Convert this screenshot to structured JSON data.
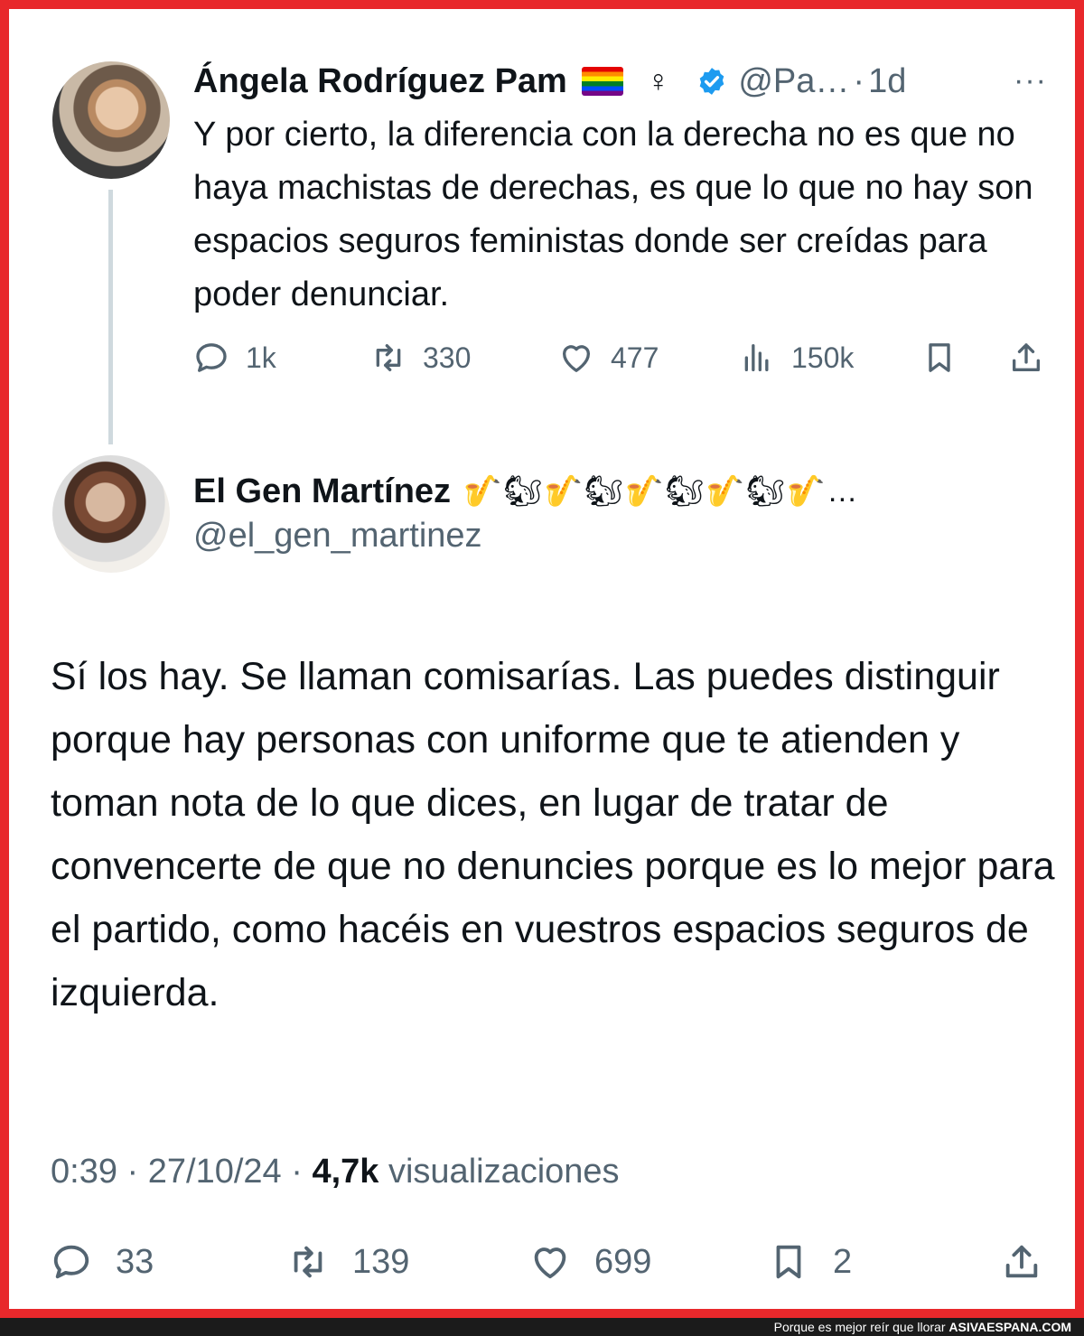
{
  "tweet_main": {
    "author_name": "Ángela Rodríguez Pam",
    "female_symbol": "♀",
    "handle_truncated": "@Pa…",
    "separator": "·",
    "time_ago": "1d",
    "more": "···",
    "text": "Y por cierto, la diferencia con la derecha no es que no haya machistas de derechas, es que lo que no hay son espacios seguros feministas donde ser creídas para poder denunciar.",
    "stats": {
      "replies": "1k",
      "retweets": "330",
      "likes": "477",
      "views": "150k"
    }
  },
  "reply": {
    "author_name": "El Gen Martínez",
    "name_emojis": "🎷🐿🎷🐿🎷🐿🎷🐿🎷…",
    "handle": "@el_gen_martinez",
    "text": "Sí los hay. Se llaman comisarías. Las puedes distinguir porque hay personas con uniforme que te atienden y toman nota de lo que dices, en lugar de tratar de convencerte de que no denuncies porque es lo mejor para el partido, como hacéis en vuestros espacios seguros de izquierda.",
    "time": "0:39",
    "date": "27/10/24",
    "separator": "·",
    "views_count": "4,7k",
    "views_label": "visualizaciones",
    "stats": {
      "replies": "33",
      "retweets": "139",
      "likes": "699",
      "bookmarks": "2"
    }
  },
  "footer": {
    "tagline": "Porque es mejor reír que llorar",
    "site": "ASIVAESPANA.COM"
  },
  "colors": {
    "frame": "#e8282b",
    "text": "#0f1419",
    "muted": "#536471",
    "verified": "#1d9bf0"
  }
}
